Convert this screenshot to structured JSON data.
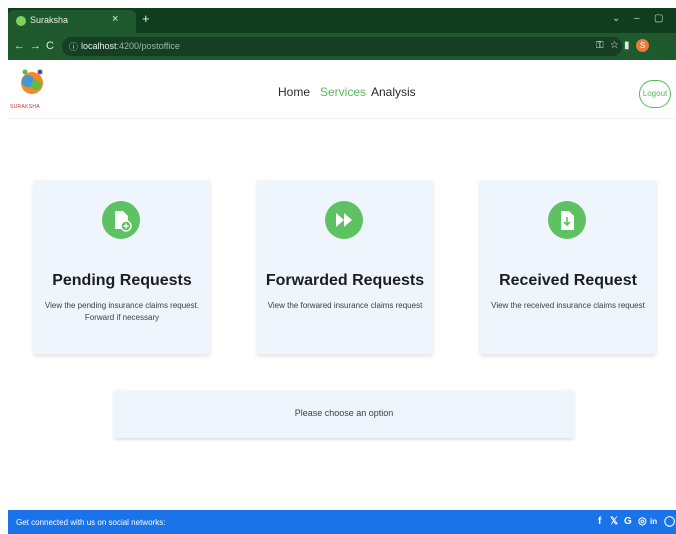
{
  "browser": {
    "tab_title": "Suraksha",
    "tab_close": "×",
    "new_tab": "+",
    "url_host": "localhost",
    "url_path": ":4200/postoffice",
    "profile_initial": "S",
    "icons": [
      "back-arrow",
      "forward-arrow",
      "reload",
      "info",
      "key",
      "share",
      "star",
      "sidebar",
      "profile"
    ]
  },
  "header": {
    "logo_text": "SURAKSHA",
    "nav": [
      {
        "label": "Home",
        "active": false
      },
      {
        "label": "Services",
        "active": true
      },
      {
        "label": "Analysis",
        "active": false
      }
    ],
    "logout_label": "Logout",
    "accent_color": "#5bb75b"
  },
  "cards": [
    {
      "title": "Pending Requests",
      "description": "View the pending insurance claims request. Forward if necessary",
      "icon": "file-plus-icon"
    },
    {
      "title": "Forwarded Requests",
      "description": "View the forwared insurance claims request",
      "icon": "fast-forward-icon"
    },
    {
      "title": "Received Request",
      "description": "View the received insurance claims request",
      "icon": "file-download-icon"
    }
  ],
  "message": "Please choose an option",
  "footer": {
    "text": "Get connected with us on social networks:",
    "social": [
      "f",
      "𝕏",
      "G",
      "◎",
      "in",
      "◯"
    ],
    "color": "#1a73e8"
  }
}
